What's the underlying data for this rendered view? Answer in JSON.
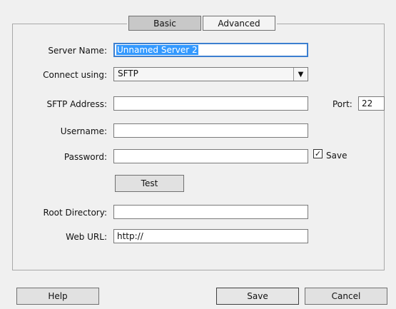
{
  "tabs": {
    "basic": "Basic",
    "advanced": "Advanced"
  },
  "form": {
    "server_name_label": "Server Name:",
    "server_name_value": "Unnamed Server 2",
    "connect_label": "Connect using:",
    "connect_value": "SFTP",
    "sftp_address_label": "SFTP Address:",
    "sftp_address_value": "",
    "port_label": "Port:",
    "port_value": "22",
    "username_label": "Username:",
    "username_value": "",
    "password_label": "Password:",
    "password_value": "",
    "save_checkbox_label": "Save",
    "save_checked": true,
    "test_button": "Test",
    "root_dir_label": "Root Directory:",
    "root_dir_value": "",
    "web_url_label": "Web URL:",
    "web_url_value": "http://"
  },
  "footer": {
    "help": "Help",
    "save": "Save",
    "cancel": "Cancel"
  }
}
